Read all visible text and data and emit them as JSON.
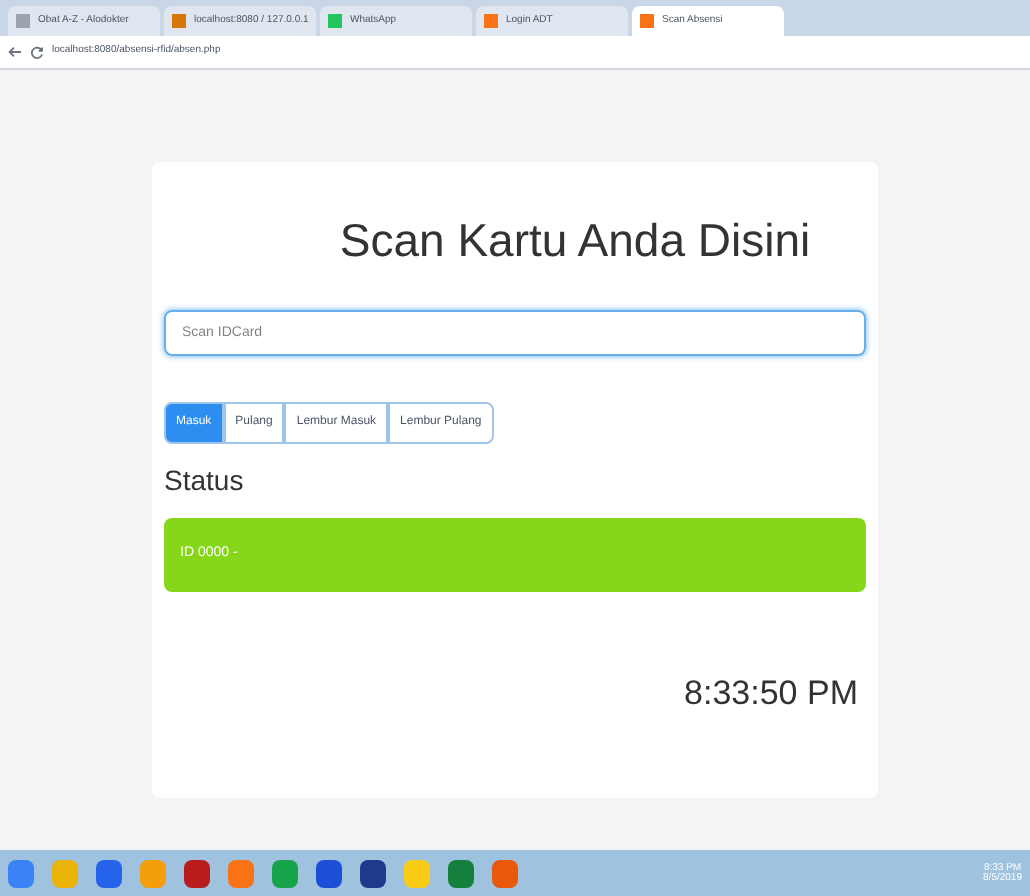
{
  "browser": {
    "tabs": [
      {
        "title": "Obat A-Z - Alodokter",
        "selected": false,
        "color": "#9ca3af"
      },
      {
        "title": "localhost:8080 / 127.0.0.1",
        "selected": false,
        "color": "#d97706"
      },
      {
        "title": "WhatsApp",
        "selected": false,
        "color": "#22c55e"
      },
      {
        "title": "Login ADT",
        "selected": false,
        "color": "#f97316"
      },
      {
        "title": "Scan Absensi",
        "selected": true,
        "color": "#f97316"
      }
    ],
    "url": "localhost:8080/absensi-rfid/absen.php"
  },
  "card": {
    "title": "Scan Kartu Anda Disini",
    "input": {
      "placeholder": "Scan IDCard"
    },
    "modes": [
      {
        "label": "Masuk",
        "selected": true
      },
      {
        "label": "Pulang",
        "selected": false
      },
      {
        "label": "Lembur Masuk",
        "selected": false
      },
      {
        "label": "Lembur Pulang",
        "selected": false
      }
    ],
    "status_heading": "Status",
    "status_message": "ID 0000 -",
    "clock": "8:33:50 PM"
  },
  "taskbar": {
    "apps": [
      {
        "color": "#3b82f6"
      },
      {
        "color": "#eab308"
      },
      {
        "color": "#2563eb"
      },
      {
        "color": "#f59e0b"
      },
      {
        "color": "#b91c1c"
      },
      {
        "color": "#f97316"
      },
      {
        "color": "#16a34a"
      },
      {
        "color": "#1d4ed8"
      },
      {
        "color": "#1e3a8a"
      },
      {
        "color": "#facc15"
      },
      {
        "color": "#15803d"
      },
      {
        "color": "#ea580c"
      }
    ],
    "time": "8:33 PM",
    "date": "8/5/2019"
  }
}
